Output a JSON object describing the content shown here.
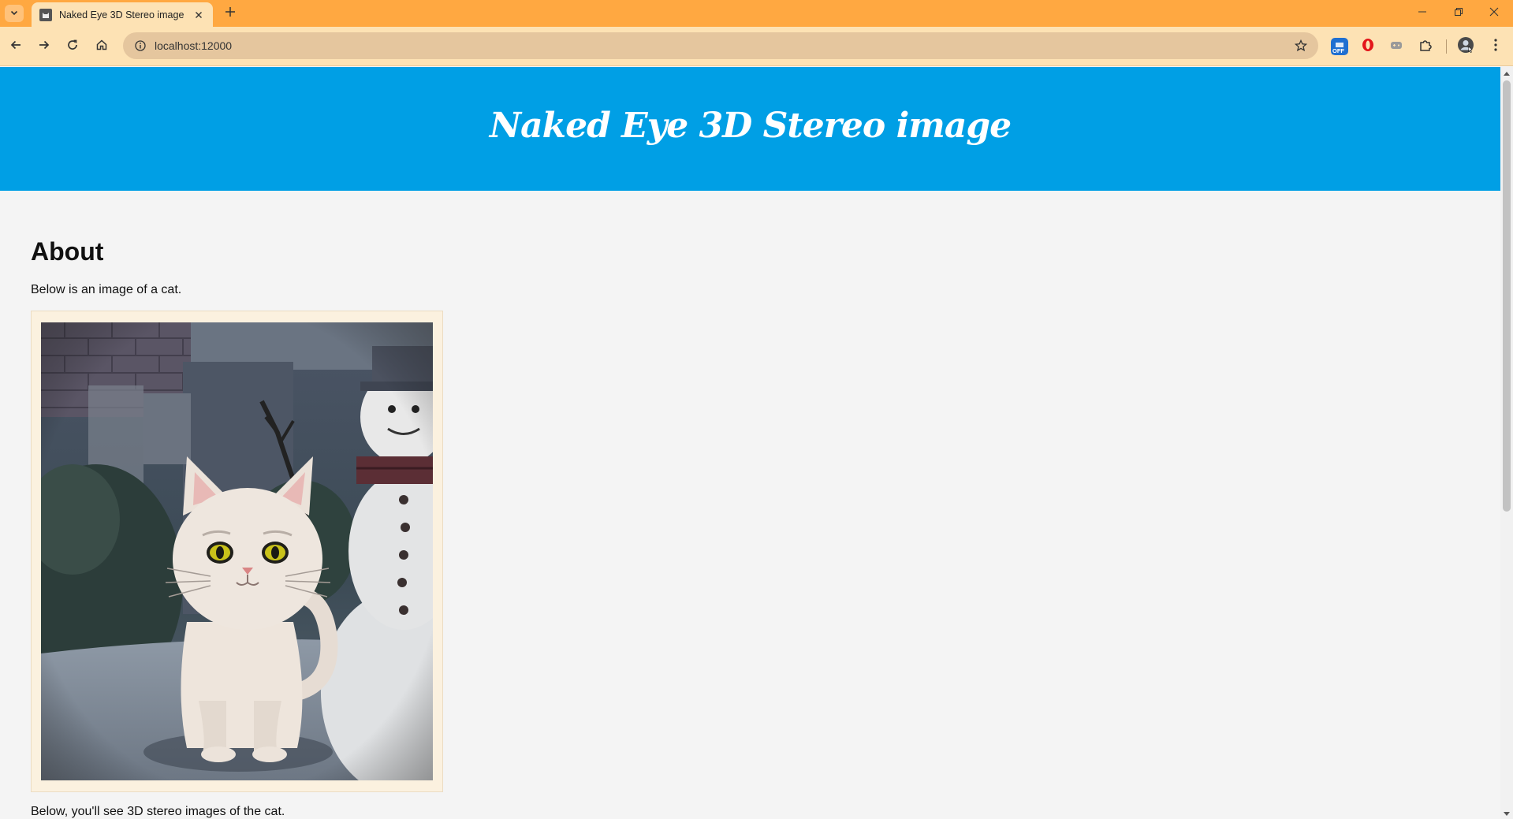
{
  "browser": {
    "tab_title": "Naked Eye 3D Stereo image",
    "url": "localhost:12000",
    "off_badge": "OFF",
    "accent_color": "#ffa841",
    "toolbar_color": "#fde2b4"
  },
  "page": {
    "site_title": "Naked Eye 3D Stereo image",
    "header_color": "#009fe5",
    "about_heading": "About",
    "intro_text": "Below is an image of a cat.",
    "image_alt": "cat",
    "followup_text": "Below, you'll see 3D stereo images of the cat."
  },
  "icons": {
    "tab_menu": "chevron-down-icon",
    "favicon": "cat-favicon-icon",
    "tab_close": "close-icon",
    "new_tab": "plus-icon",
    "minimize": "minimize-icon",
    "restore": "restore-icon",
    "close_window": "close-icon",
    "back": "arrow-left-icon",
    "forward": "arrow-right-icon",
    "reload": "reload-icon",
    "home": "home-icon",
    "site_info": "info-icon",
    "bookmark": "star-icon",
    "extension_1": "extension-off-icon",
    "extension_2": "opera-icon",
    "extension_3": "gamepad-icon",
    "extensions": "puzzle-icon",
    "profile": "avatar-icon",
    "menu": "kebab-menu-icon"
  }
}
